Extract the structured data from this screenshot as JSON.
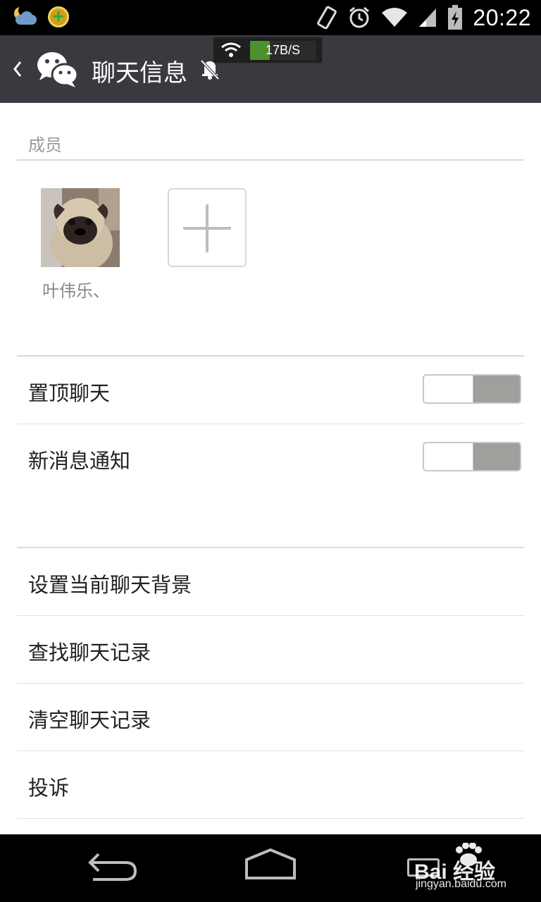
{
  "status_bar": {
    "time": "20:22",
    "icons": [
      "weather-icon",
      "app-plus-icon",
      "vibrate-icon",
      "alarm-icon",
      "wifi-icon",
      "signal-icon",
      "battery-charging-icon"
    ]
  },
  "network_overlay": {
    "speed": "17B/S"
  },
  "title_bar": {
    "title": "聊天信息",
    "back_icon": "chevron-left-icon",
    "app_icon": "wechat-icon",
    "mute_icon": "muted-bell-icon"
  },
  "members_section": {
    "header": "成员",
    "members": [
      {
        "name": "叶伟乐、"
      }
    ],
    "add_icon": "plus-icon"
  },
  "settings": {
    "pin_chat": {
      "label": "置顶聊天",
      "enabled": false
    },
    "new_message_notify": {
      "label": "新消息通知",
      "enabled": false
    }
  },
  "actions": [
    {
      "label": "设置当前聊天背景"
    },
    {
      "label": "查找聊天记录"
    },
    {
      "label": "清空聊天记录"
    },
    {
      "label": "投诉"
    }
  ],
  "watermark": {
    "main": "Bai 经验",
    "sub": "jingyan.baidu.com"
  },
  "colors": {
    "title_bar": "#393a3f",
    "toggle_off": "#9da09b",
    "divider": "#d9d9d9"
  }
}
